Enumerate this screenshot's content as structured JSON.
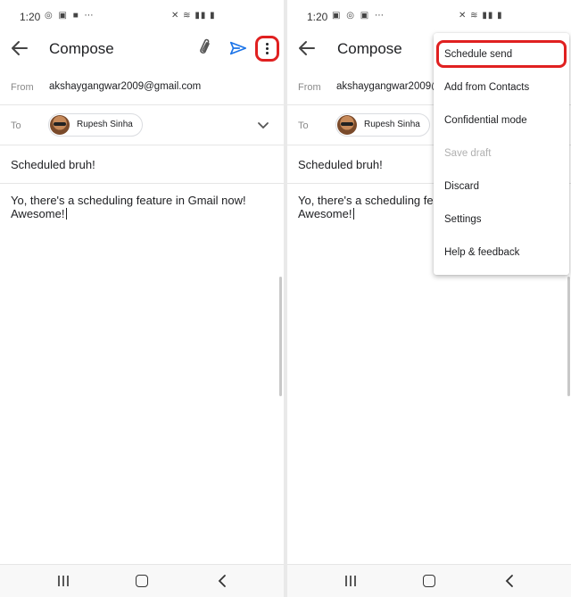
{
  "left": {
    "status": {
      "time": "1:20",
      "icons_left": "◎ ▣ ■ ⋯",
      "icons_right": "✕ ≋ ▮▮ ▮"
    },
    "header": {
      "title": "Compose"
    },
    "from": {
      "label": "From",
      "value": "akshaygangwar2009@gmail.com"
    },
    "to": {
      "label": "To",
      "recipient": "Rupesh Sinha"
    },
    "subject": "Scheduled bruh!",
    "body": "Yo, there's a scheduling feature in Gmail now! Awesome!"
  },
  "right": {
    "status": {
      "time": "1:20",
      "icons_left": "▣ ◎ ▣ ⋯",
      "icons_right": "✕ ≋ ▮▮ ▮"
    },
    "header": {
      "title": "Compose"
    },
    "from": {
      "label": "From",
      "value": "akshaygangwar2009@"
    },
    "to": {
      "label": "To",
      "recipient": "Rupesh Sinha"
    },
    "subject": "Scheduled bruh!",
    "body_line1": "Yo, there's a scheduling fea",
    "body_line2": "Awesome!",
    "menu": {
      "items": [
        {
          "label": "Schedule send"
        },
        {
          "label": "Add from Contacts"
        },
        {
          "label": "Confidential mode"
        },
        {
          "label": "Save draft",
          "disabled": true
        },
        {
          "label": "Discard"
        },
        {
          "label": "Settings"
        },
        {
          "label": "Help & feedback"
        }
      ]
    }
  },
  "icons": {
    "back": "arrow-left-icon",
    "attach": "paperclip-icon",
    "send": "send-icon",
    "more": "more-vert-icon",
    "expand": "chevron-down-icon",
    "nav_recents": "recents-icon",
    "nav_home": "home-icon",
    "nav_back": "nav-back-icon"
  },
  "colors": {
    "highlight": "#e02020",
    "send": "#1a73e8",
    "text": "#202124",
    "label": "#8a8a8a"
  }
}
